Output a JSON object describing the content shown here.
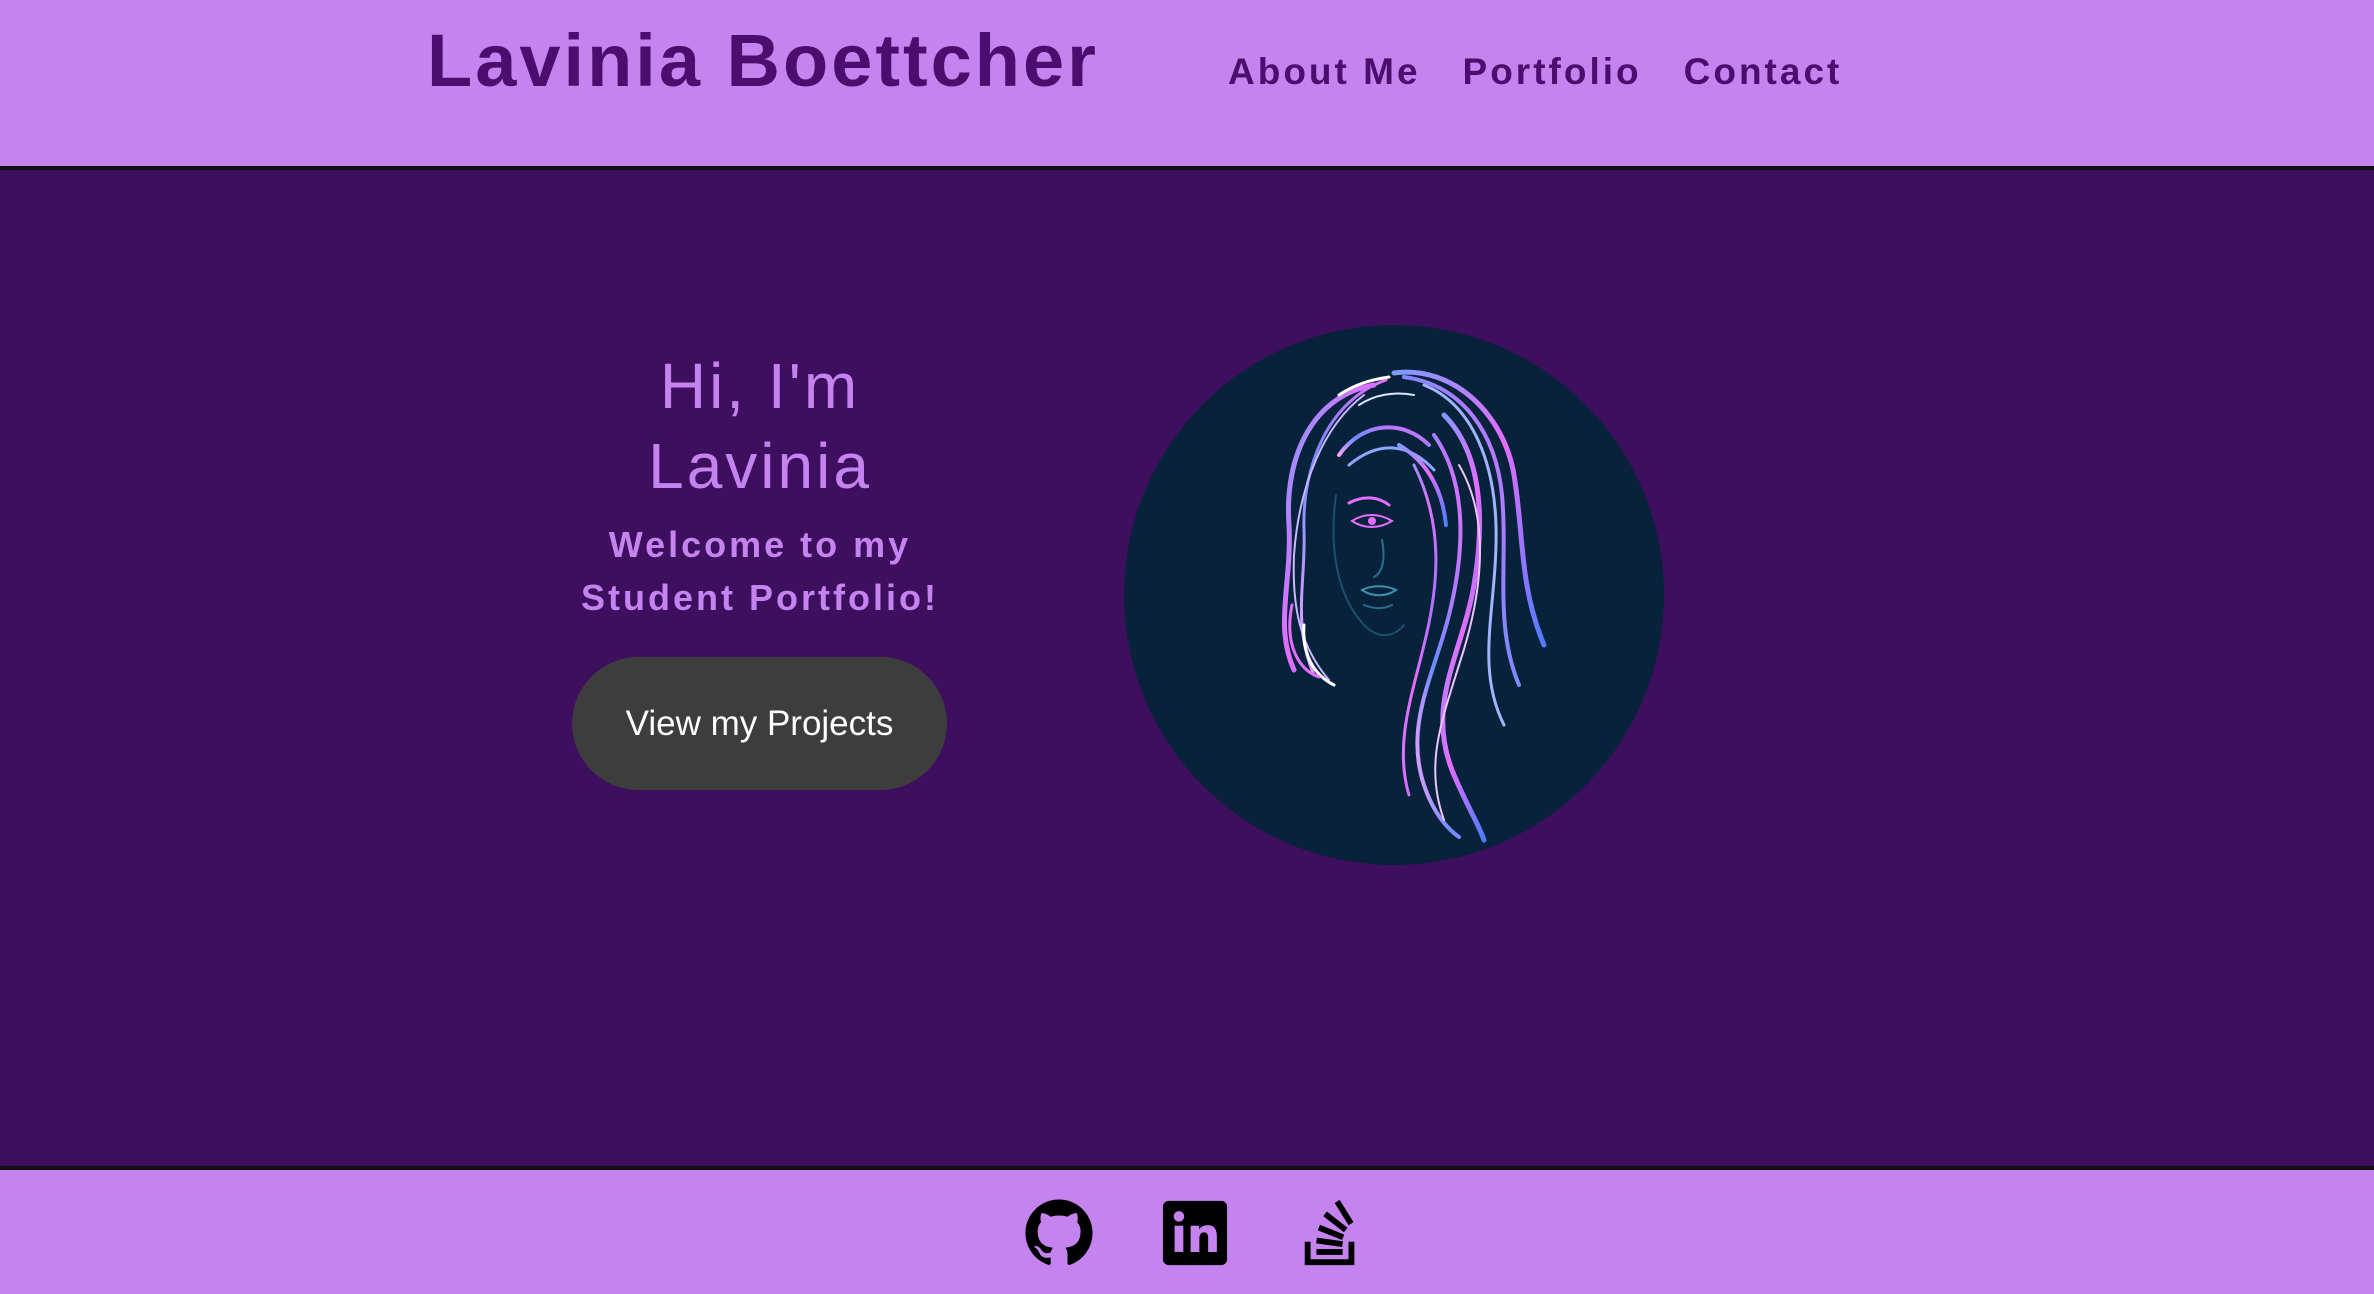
{
  "header": {
    "title": "Lavinia Boettcher",
    "nav": [
      "About Me",
      "Portfolio",
      "Contact"
    ]
  },
  "hero": {
    "heading": "Hi, I'm Lavinia",
    "subheading": "Welcome to my Student Portfolio!",
    "cta_label": "View my Projects",
    "portrait_icon": "woman-line-art-portrait"
  },
  "footer": {
    "icons": [
      "github-icon",
      "linkedin-icon",
      "stackoverflow-icon"
    ]
  },
  "colors": {
    "header_bg": "#c583f0",
    "hero_bg": "#3d0f5e",
    "title_text": "#4a0f6e",
    "accent_text": "#c583f0",
    "button_bg": "#3d3d3d",
    "portrait_bg": "#07223a"
  }
}
